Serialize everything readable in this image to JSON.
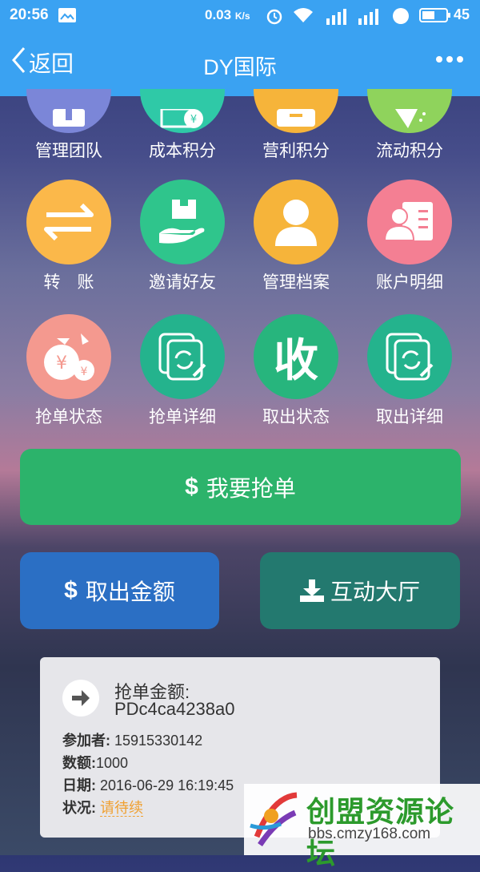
{
  "status_bar": {
    "time": "20:56",
    "network_speed": "0.03",
    "speed_unit": "K/s",
    "battery": "45"
  },
  "nav": {
    "back_label": "返回",
    "title": "DY国际"
  },
  "grid": {
    "row0": [
      {
        "label": "管理团队",
        "color": "#7b86d8",
        "icon": "team-icon"
      },
      {
        "label": "成本积分",
        "color": "#2fc9a7",
        "icon": "cost-points-icon"
      },
      {
        "label": "营利积分",
        "color": "#f6b43a",
        "icon": "profit-points-icon"
      },
      {
        "label": "流动积分",
        "color": "#8fd35c",
        "icon": "flow-points-icon"
      }
    ],
    "row1": [
      {
        "label": "转　账",
        "color": "#fbb84a",
        "icon": "transfer-icon"
      },
      {
        "label": "邀请好友",
        "color": "#2fc58c",
        "icon": "invite-friends-icon"
      },
      {
        "label": "管理档案",
        "color": "#f6b43a",
        "icon": "profile-icon"
      },
      {
        "label": "账户明细",
        "color": "#f47f93",
        "icon": "account-detail-icon"
      }
    ],
    "row2": [
      {
        "label": "抢单状态",
        "color": "#f4998f",
        "icon": "money-bag-icon"
      },
      {
        "label": "抢单详细",
        "color": "#24b38d",
        "icon": "edit-refresh-icon"
      },
      {
        "label": "取出状态",
        "color": "#27b57d",
        "icon": "receive-icon"
      },
      {
        "label": "取出详细",
        "color": "#24b38d",
        "icon": "edit-refresh-icon"
      }
    ],
    "receive_glyph": "收"
  },
  "buttons": {
    "grab_order": "我要抢单",
    "withdraw": "取出金额",
    "lobby": "互动大厅",
    "dollar": "$"
  },
  "card": {
    "amount_label": "抢单金额:",
    "amount_value": "PDc4ca4238a0",
    "participant_label": "参加者:",
    "participant_value": " 15915330142",
    "quantity_label": "数额:",
    "quantity_value": "1000",
    "date_label": "日期:",
    "date_value": " 2016-06-29 16:19:45",
    "status_label": "状况:",
    "status_value": "请待续"
  },
  "watermark": {
    "title": "创盟资源论坛",
    "url": "bbs.cmzy168.com"
  },
  "colors": {
    "nav_bg": "#3aa2f2",
    "grab_button": "#2cb36b",
    "withdraw_button": "#2b6fc4",
    "lobby_button": "#23796f",
    "pending_status": "#f0a030"
  }
}
